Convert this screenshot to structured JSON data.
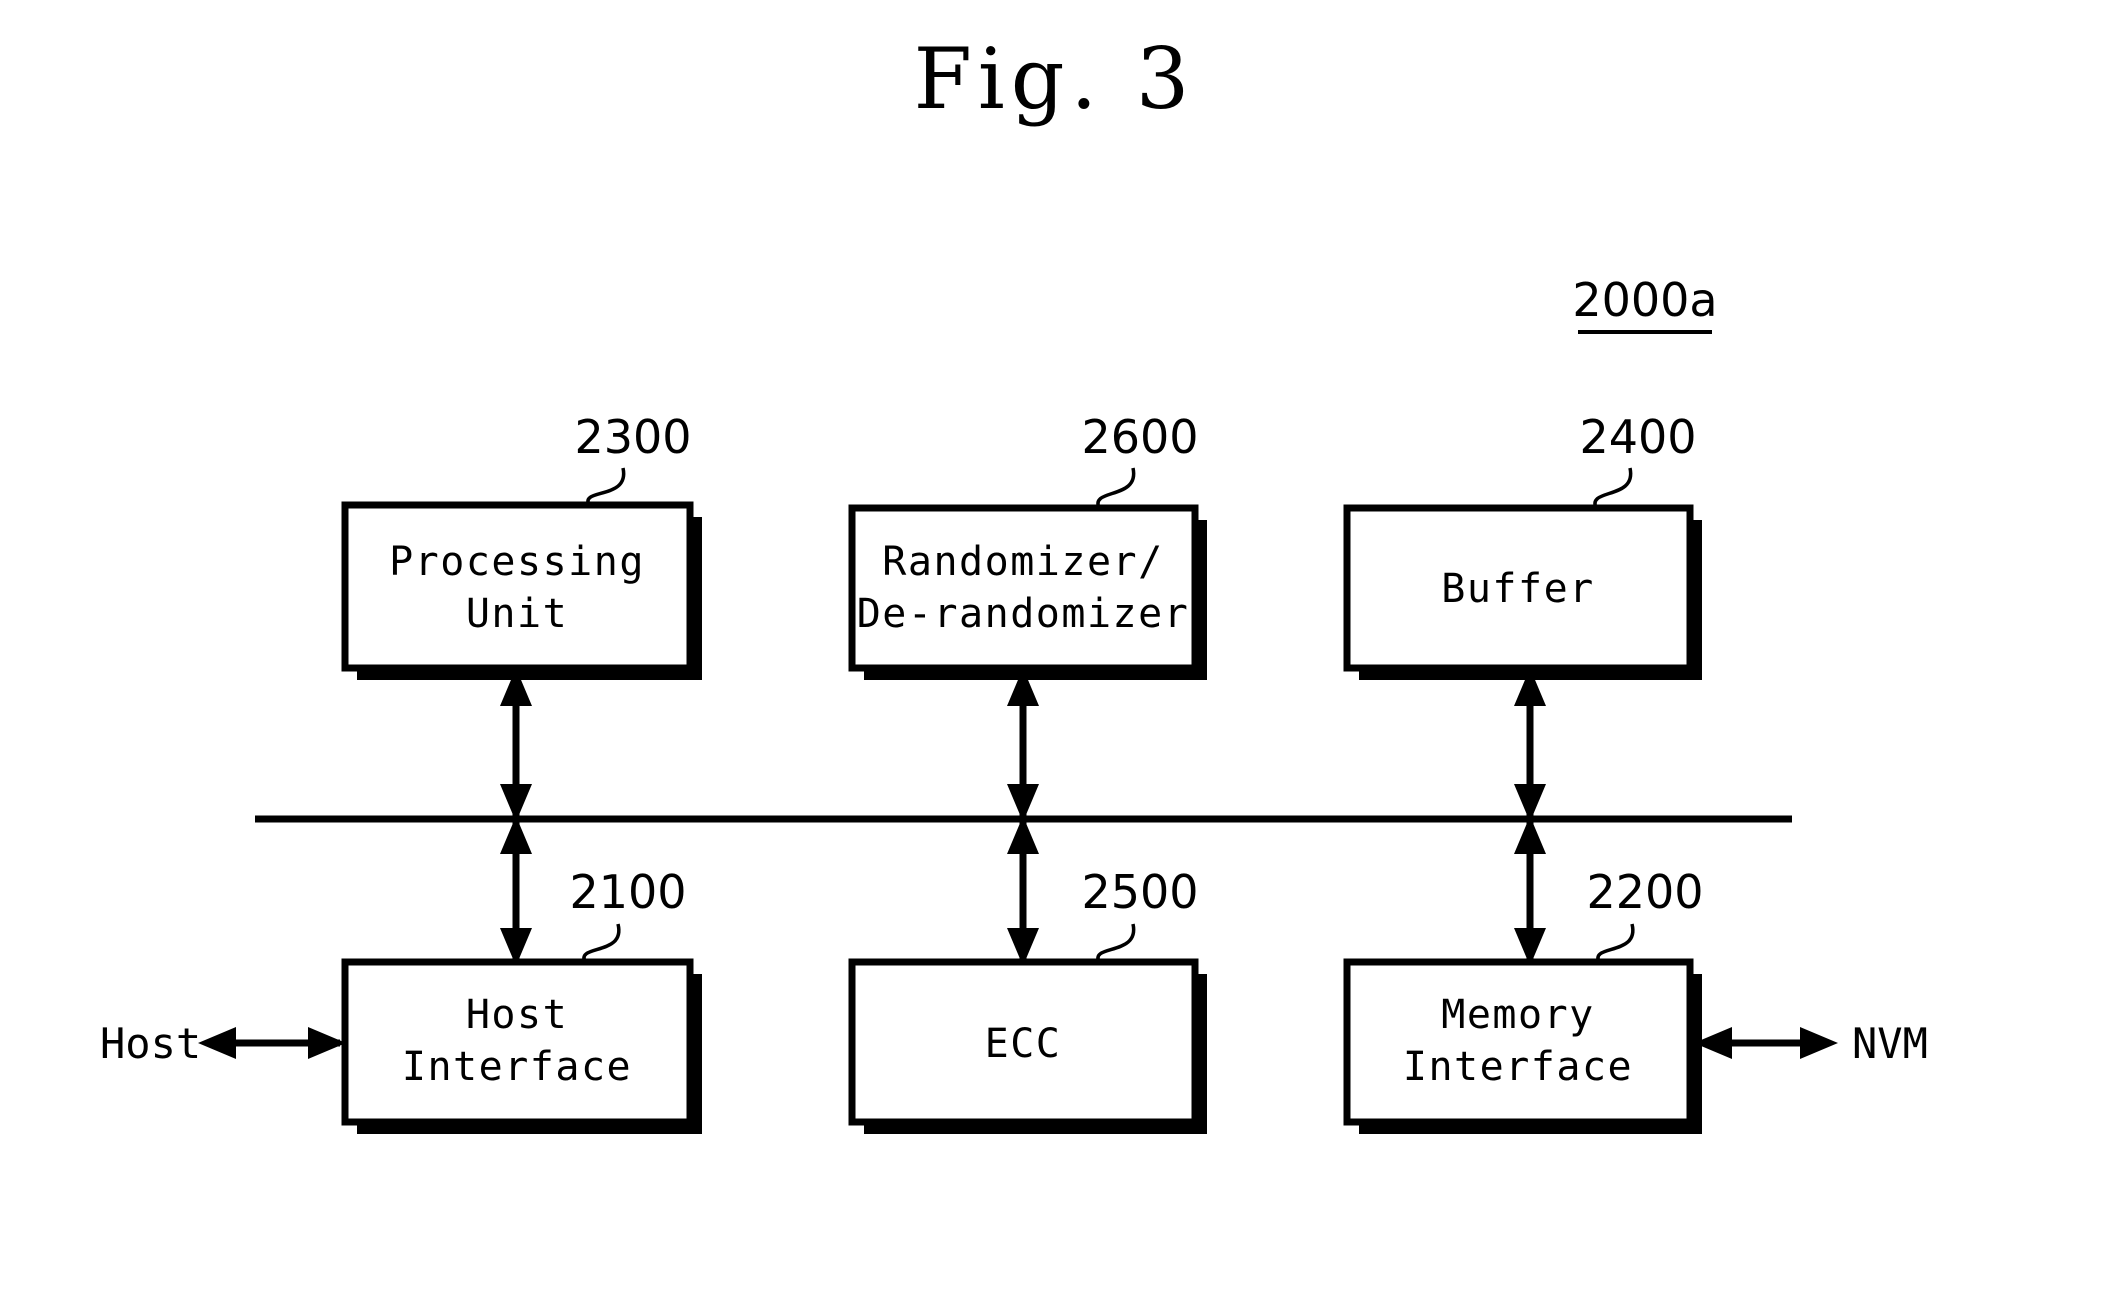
{
  "figure": {
    "title": "Fig. 3",
    "system_label": "2000a"
  },
  "blocks": [
    {
      "id": "processing-unit",
      "ref": "2300",
      "lines": [
        "Processing",
        "Unit"
      ],
      "row": "top",
      "column": 1
    },
    {
      "id": "randomizer",
      "ref": "2600",
      "lines": [
        "Randomizer/",
        "De-randomizer"
      ],
      "row": "top",
      "column": 2
    },
    {
      "id": "buffer",
      "ref": "2400",
      "lines": [
        "Buffer"
      ],
      "row": "top",
      "column": 3
    },
    {
      "id": "host-interface",
      "ref": "2100",
      "lines": [
        "Host",
        "Interface"
      ],
      "row": "bottom",
      "column": 1
    },
    {
      "id": "ecc",
      "ref": "2500",
      "lines": [
        "ECC"
      ],
      "row": "bottom",
      "column": 2
    },
    {
      "id": "memory-interface",
      "ref": "2200",
      "lines": [
        "Memory",
        "Interface"
      ],
      "row": "bottom",
      "column": 3
    }
  ],
  "external": {
    "host": "Host",
    "nvm": "NVM"
  },
  "colors": {
    "ink": "#000000",
    "paper": "#ffffff"
  }
}
